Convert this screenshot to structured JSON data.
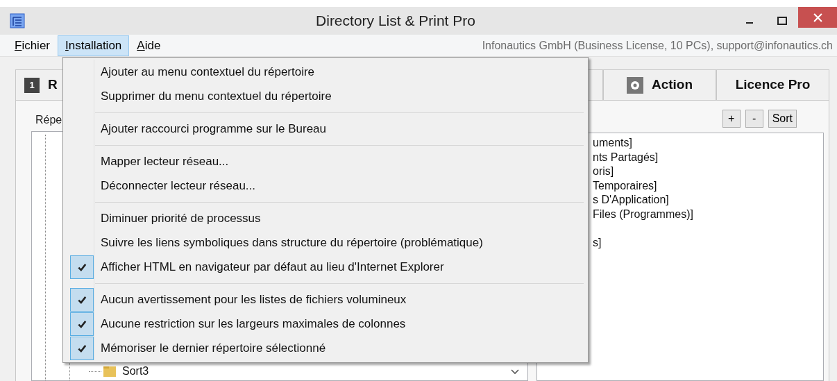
{
  "window": {
    "title": "Directory List & Print Pro"
  },
  "menubar": {
    "items": [
      {
        "label": "Fichier",
        "selected": false
      },
      {
        "label": "Installation",
        "selected": true
      },
      {
        "label": "Aide",
        "selected": false
      }
    ],
    "info": "Infonautics GmbH (Business License, 10 PCs), support@infonautics.ch"
  },
  "tabs": [
    {
      "number": "1",
      "label": "R",
      "kind": "numbered"
    },
    {
      "kind": "plain"
    },
    {
      "label": "Action",
      "kind": "gear"
    },
    {
      "label": "Licence Pro",
      "kind": "plain"
    }
  ],
  "left_panel": {
    "label": "Répe",
    "tree_items": [
      {
        "label": "Sort3"
      }
    ]
  },
  "right_panel": {
    "buttons": [
      "+",
      "-",
      "Sort"
    ],
    "list_items": [
      {
        "label": "uments]"
      },
      {
        "label": "nts Partagés]"
      },
      {
        "label": "oris]"
      },
      {
        "label": "Temporaires]"
      },
      {
        "label": "s D'Application]"
      },
      {
        "label": "Files (Programmes)]"
      },
      {
        "label": "s]",
        "blank_before": true
      }
    ]
  },
  "menu": {
    "items": [
      {
        "kind": "item",
        "label": "Ajouter au menu contextuel du répertoire",
        "checked": false
      },
      {
        "kind": "item",
        "label": "Supprimer du menu contextuel du répertoire",
        "checked": false
      },
      {
        "kind": "separator"
      },
      {
        "kind": "item",
        "label": "Ajouter raccourci programme sur le Bureau",
        "checked": false
      },
      {
        "kind": "separator"
      },
      {
        "kind": "item",
        "label": "Mapper lecteur réseau...",
        "checked": false
      },
      {
        "kind": "item",
        "label": "Déconnecter lecteur réseau...",
        "checked": false
      },
      {
        "kind": "separator"
      },
      {
        "kind": "item",
        "label": "Diminuer priorité de processus",
        "checked": false
      },
      {
        "kind": "item",
        "label": "Suivre les liens symboliques dans structure du répertoire (problématique)",
        "checked": false
      },
      {
        "kind": "item",
        "label": "Afficher HTML en navigateur par défaut au lieu d'Internet Explorer",
        "checked": true
      },
      {
        "kind": "separator"
      },
      {
        "kind": "item",
        "label": "Aucun avertissement pour les listes de fichiers volumineux",
        "checked": true
      },
      {
        "kind": "item",
        "label": "Aucune restriction sur les largeurs maximales de colonnes",
        "checked": true
      },
      {
        "kind": "item",
        "label": "Mémoriser le dernier répertoire sélectionné",
        "checked": true
      }
    ]
  }
}
